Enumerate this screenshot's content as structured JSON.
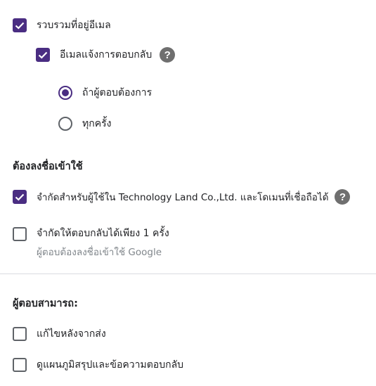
{
  "collect_email": {
    "label": "รวบรวมที่อยู่อีเมล",
    "checked": true
  },
  "response_receipts": {
    "label": "อีเมลแจ้งการตอบกลับ",
    "checked": true,
    "help_icon": "?"
  },
  "receipt_options": [
    {
      "label": "ถ้าผู้ตอบต้องการ",
      "selected": true
    },
    {
      "label": "ทุกครั้ง",
      "selected": false
    }
  ],
  "sign_in_section": {
    "heading": "ต้องลงชื่อเข้าใช้",
    "restrict_domain": {
      "label": "จำกัดสำหรับผู้ใช้ใน Technology Land Co.,Ltd. และโดเมนที่เชื่อถือได้",
      "checked": true,
      "help_icon": "?"
    },
    "limit_one": {
      "label": "จำกัดให้ตอบกลับได้เพียง 1 ครั้ง",
      "sublabel": "ผู้ตอบต้องลงชื่อเข้าใช้ Google",
      "checked": false
    }
  },
  "respondents_section": {
    "heading": "ผู้ตอบสามารถ:",
    "edit_after": {
      "label": "แก้ไขหลังจากส่ง",
      "checked": false
    },
    "see_summary": {
      "label": "ดูแผนภูมิสรุปและข้อความตอบกลับ",
      "checked": false
    }
  },
  "colors": {
    "accent": "#4a2d82",
    "icon_gray": "#6f6f6f",
    "divider": "#dadce0"
  }
}
